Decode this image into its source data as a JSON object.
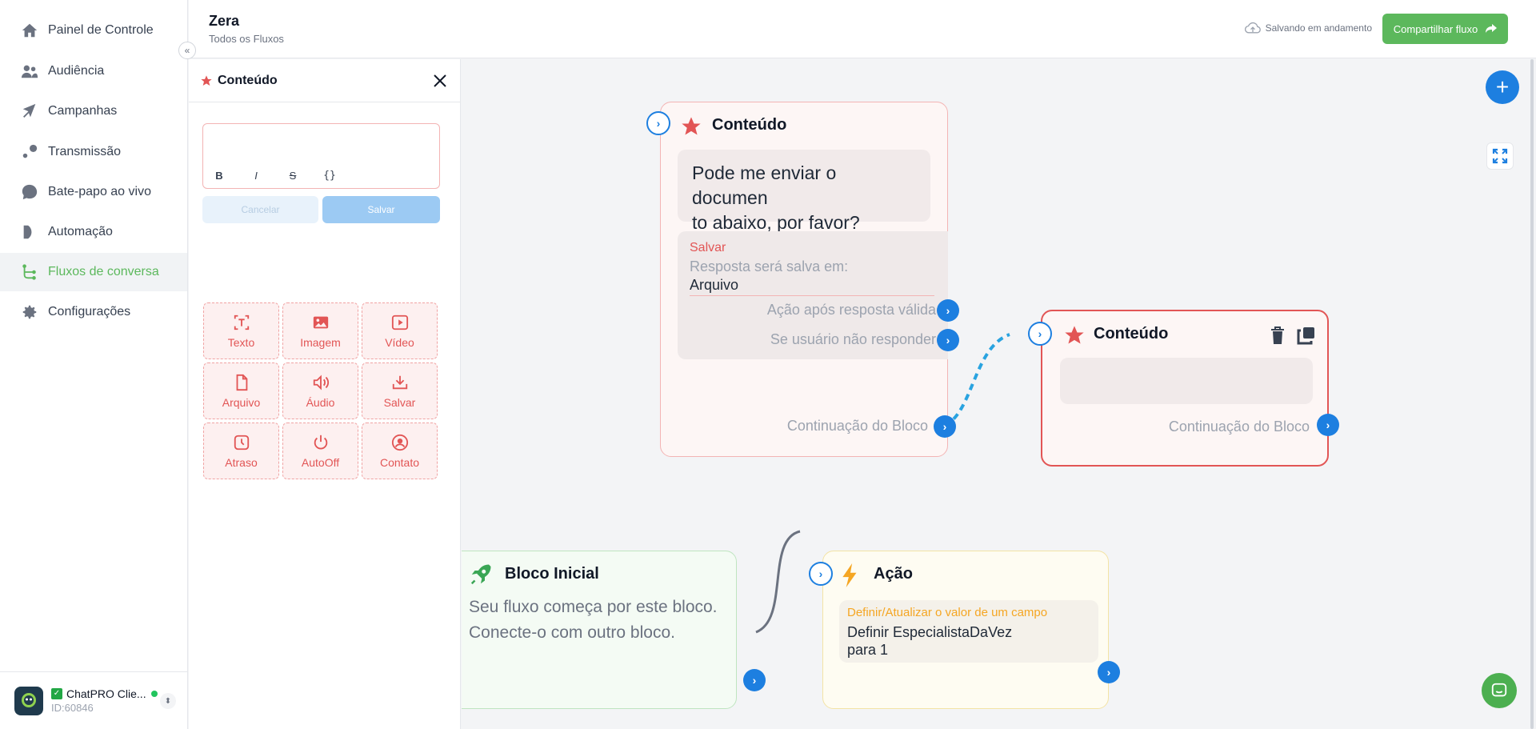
{
  "sidebar": {
    "items": [
      {
        "label": "Painel de Controle",
        "icon": "home-icon"
      },
      {
        "label": "Audiência",
        "icon": "users-icon"
      },
      {
        "label": "Campanhas",
        "icon": "campaign-icon"
      },
      {
        "label": "Transmissão",
        "icon": "broadcast-icon"
      },
      {
        "label": "Bate-papo ao vivo",
        "icon": "chat-bubble-icon"
      },
      {
        "label": "Automação",
        "icon": "automation-icon"
      },
      {
        "label": "Fluxos de conversa",
        "icon": "flow-icon"
      },
      {
        "label": "Configurações",
        "icon": "gear-icon"
      }
    ],
    "active_index": 6,
    "account": {
      "name": "ChatPRO Clie...",
      "id": "ID:60846"
    }
  },
  "header": {
    "title": "Zera",
    "subtitle": "Todos os Fluxos",
    "saving": "Salvando em andamento",
    "share": "Compartilhar fluxo"
  },
  "panel": {
    "title": "Conteúdo",
    "tools": [
      "B",
      "I",
      "S",
      "{}"
    ],
    "cancel": "Cancelar",
    "save": "Salvar",
    "tiles": [
      {
        "label": "Texto",
        "icon": "text-icon"
      },
      {
        "label": "Imagem",
        "icon": "image-icon"
      },
      {
        "label": "Vídeo",
        "icon": "video-icon"
      },
      {
        "label": "Arquivo",
        "icon": "file-icon"
      },
      {
        "label": "Áudio",
        "icon": "audio-icon"
      },
      {
        "label": "Salvar",
        "icon": "save-icon"
      },
      {
        "label": "Atraso",
        "icon": "clock-icon"
      },
      {
        "label": "AutoOff",
        "icon": "power-icon"
      },
      {
        "label": "Contato",
        "icon": "contact-icon"
      }
    ]
  },
  "nodes": {
    "content1": {
      "title": "Conteúdo",
      "message_line1": "Pode me enviar o documen",
      "message_line2": "to abaixo, por favor?",
      "save_label": "Salvar",
      "save_desc": "Resposta será salva em:",
      "save_field": "Arquivo",
      "valid_action": "Ação após resposta válida",
      "no_response": "Se usuário não responder",
      "continuation": "Continuação do Bloco"
    },
    "content2": {
      "title": "Conteúdo",
      "continuation": "Continuação do Bloco"
    },
    "start": {
      "title": "Bloco Inicial",
      "desc_line1": "Seu fluxo começa por este bloco.",
      "desc_line2": "Conecte-o com outro bloco."
    },
    "action": {
      "title": "Ação",
      "type": "Definir/Atualizar o valor de um campo",
      "line1": "Definir EspecialistaDaVez",
      "line2": "para 1"
    }
  },
  "colors": {
    "accent_green": "#5cb85c",
    "connector_blue": "#1d7fe0",
    "content_red": "#e25555",
    "action_yellow": "#f5a623"
  }
}
